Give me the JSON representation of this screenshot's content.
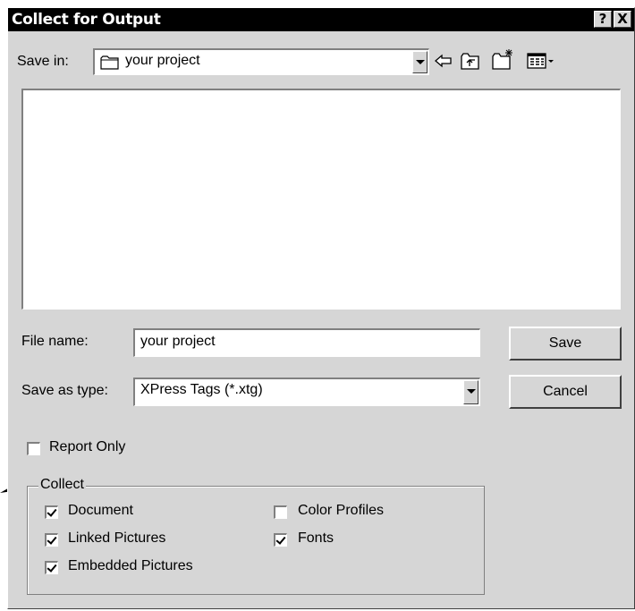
{
  "dialog": {
    "title": "Collect for Output",
    "help_glyph": "?",
    "close_glyph": "X"
  },
  "toolbar": {
    "save_in_label": "Save in:",
    "save_in_value": "your project",
    "icons": [
      "folder-icon",
      "back-arrow-icon",
      "up-folder-icon",
      "new-folder-icon",
      "view-menu-icon"
    ]
  },
  "form": {
    "file_name_label": "File name:",
    "file_name_value": "your project",
    "save_as_type_label": "Save as type:",
    "save_as_type_value": "XPress Tags (*.xtg)"
  },
  "buttons": {
    "save": "Save",
    "cancel": "Cancel"
  },
  "options": {
    "report_only": {
      "label": "Report Only",
      "checked": false
    }
  },
  "collect": {
    "group_label": "Collect",
    "items": [
      {
        "label": "Document",
        "checked": true
      },
      {
        "label": "Linked Pictures",
        "checked": true
      },
      {
        "label": "Embedded Pictures",
        "checked": true
      },
      {
        "label": "Color Profiles",
        "checked": false
      },
      {
        "label": "Fonts",
        "checked": true
      }
    ]
  }
}
